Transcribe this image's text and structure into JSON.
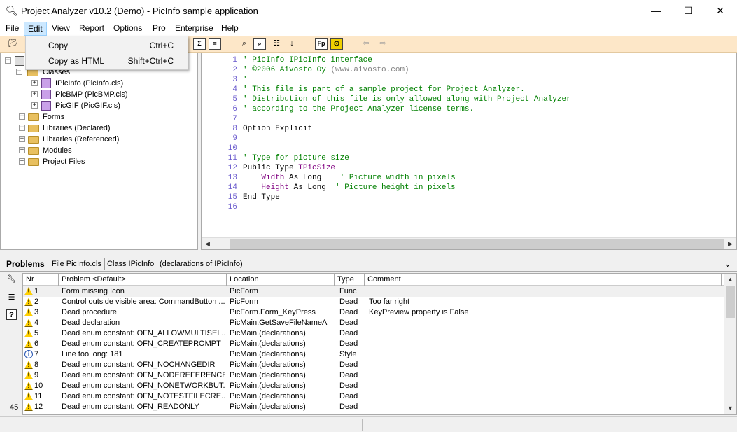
{
  "window": {
    "title": "Project Analyzer v10.2 (Demo) - PicInfo sample application",
    "app_icon": "magnifier-icon",
    "minimize": "—",
    "maximize": "☐",
    "close": "✕"
  },
  "menu": {
    "items": [
      "File",
      "Edit",
      "View",
      "Report",
      "Options",
      "Pro",
      "Enterprise",
      "Help"
    ],
    "active": "Edit"
  },
  "edit_menu": {
    "items": [
      {
        "label": "Copy",
        "shortcut": "Ctrl+C"
      },
      {
        "label": "Copy as HTML",
        "shortcut": "Shift+Ctrl+C"
      }
    ]
  },
  "toolbar": {
    "buttons": [
      "open-folder-icon",
      "sum-icon",
      "report-icon",
      "find-icon",
      "find-doc-icon",
      "flowchart-icon",
      "enum-icon",
      "fp-icon",
      "gear-icon",
      "back-arrow-icon",
      "forward-arrow-icon"
    ],
    "sum_glyph": "Σ",
    "fp_label": "Fp"
  },
  "tree": {
    "root_collapse": "−",
    "classes_label": "Classes",
    "expand_glyph": "+",
    "items": [
      {
        "label": "IPicInfo (PicInfo.cls)",
        "kind": "class"
      },
      {
        "label": "PicBMP (PicBMP.cls)",
        "kind": "class"
      },
      {
        "label": "PicGIF (PicGIF.cls)",
        "kind": "class"
      },
      {
        "label": "Forms",
        "kind": "folder"
      },
      {
        "label": "Libraries (Declared)",
        "kind": "folder"
      },
      {
        "label": "Libraries (Referenced)",
        "kind": "folder"
      },
      {
        "label": "Modules",
        "kind": "folder"
      },
      {
        "label": "Project Files",
        "kind": "folder"
      }
    ]
  },
  "code": {
    "lines": [
      {
        "n": "1",
        "parts": [
          {
            "t": "' PicInfo IPicInfo interface",
            "c": "c-comment"
          }
        ]
      },
      {
        "n": "2",
        "parts": [
          {
            "t": "' ©2006 Aivosto Oy ",
            "c": "c-comment"
          },
          {
            "t": "(www.aivosto.com)",
            "c": "c-gray"
          }
        ]
      },
      {
        "n": "3",
        "parts": [
          {
            "t": "'",
            "c": "c-comment"
          }
        ]
      },
      {
        "n": "4",
        "parts": [
          {
            "t": "' This file is part of a sample project for Project Analyzer.",
            "c": "c-comment"
          }
        ]
      },
      {
        "n": "5",
        "parts": [
          {
            "t": "' Distribution of this file is only allowed along with Project Analyzer",
            "c": "c-comment"
          }
        ]
      },
      {
        "n": "6",
        "parts": [
          {
            "t": "' according to the Project Analyzer license terms.",
            "c": "c-comment"
          }
        ]
      },
      {
        "n": "7",
        "parts": []
      },
      {
        "n": "8",
        "parts": [
          {
            "t": "Option Explicit",
            "c": ""
          }
        ]
      },
      {
        "n": "9",
        "parts": []
      },
      {
        "n": "10",
        "parts": []
      },
      {
        "n": "11",
        "parts": [
          {
            "t": "' Type for picture size",
            "c": "c-comment"
          }
        ]
      },
      {
        "n": "12",
        "parts": [
          {
            "t": "Public Type ",
            "c": ""
          },
          {
            "t": "TPicSize",
            "c": "c-type"
          }
        ]
      },
      {
        "n": "13",
        "parts": [
          {
            "t": "    ",
            "c": ""
          },
          {
            "t": "Width",
            "c": "c-var"
          },
          {
            "t": " As Long    ",
            "c": ""
          },
          {
            "t": "' Picture width in pixels",
            "c": "c-comment"
          }
        ]
      },
      {
        "n": "14",
        "parts": [
          {
            "t": "    ",
            "c": ""
          },
          {
            "t": "Height",
            "c": "c-var"
          },
          {
            "t": " As Long  ",
            "c": ""
          },
          {
            "t": "' Picture height in pixels",
            "c": "c-comment"
          }
        ]
      },
      {
        "n": "15",
        "parts": [
          {
            "t": "End Type",
            "c": ""
          }
        ]
      },
      {
        "n": "16",
        "parts": []
      }
    ]
  },
  "tabs": {
    "items": [
      "Problems",
      "File PicInfo.cls",
      "Class IPicInfo",
      "(declarations of IPicInfo)"
    ],
    "menu_glyph": "⌄"
  },
  "side_tools": {
    "icons": [
      "wrench-icon",
      "checklist-icon",
      "help-icon"
    ],
    "count": "45"
  },
  "problems": {
    "columns": [
      "Nr",
      "Problem <Default>",
      "Location",
      "Type",
      "Comment"
    ],
    "rows": [
      {
        "icon": "warning",
        "nr": "1",
        "problem": "Form missing Icon",
        "location": "PicForm",
        "type": "Func",
        "comment": ""
      },
      {
        "icon": "warning",
        "nr": "2",
        "problem": "Control outside visible area: CommandButton ...",
        "location": "PicForm",
        "type": "Dead",
        "comment": "Too far right"
      },
      {
        "icon": "warning",
        "nr": "3",
        "problem": "Dead procedure",
        "location": "PicForm.Form_KeyPress",
        "type": "Dead",
        "comment": "KeyPreview property is False"
      },
      {
        "icon": "warning",
        "nr": "4",
        "problem": "Dead declaration",
        "location": "PicMain.GetSaveFileNameA",
        "type": "Dead",
        "comment": ""
      },
      {
        "icon": "warning",
        "nr": "5",
        "problem": "Dead enum constant: OFN_ALLOWMULTISEL...",
        "location": "PicMain.(declarations)",
        "type": "Dead",
        "comment": ""
      },
      {
        "icon": "warning",
        "nr": "6",
        "problem": "Dead enum constant: OFN_CREATEPROMPT",
        "location": "PicMain.(declarations)",
        "type": "Dead",
        "comment": ""
      },
      {
        "icon": "info",
        "nr": "7",
        "problem": "Line too long: 181",
        "location": "PicMain.(declarations)",
        "type": "Style",
        "comment": ""
      },
      {
        "icon": "warning",
        "nr": "8",
        "problem": "Dead enum constant: OFN_NOCHANGEDIR",
        "location": "PicMain.(declarations)",
        "type": "Dead",
        "comment": ""
      },
      {
        "icon": "warning",
        "nr": "9",
        "problem": "Dead enum constant: OFN_NODEREFERENCE...",
        "location": "PicMain.(declarations)",
        "type": "Dead",
        "comment": ""
      },
      {
        "icon": "warning",
        "nr": "10",
        "problem": "Dead enum constant: OFN_NONETWORKBUT...",
        "location": "PicMain.(declarations)",
        "type": "Dead",
        "comment": ""
      },
      {
        "icon": "warning",
        "nr": "11",
        "problem": "Dead enum constant: OFN_NOTESTFILECRE...",
        "location": "PicMain.(declarations)",
        "type": "Dead",
        "comment": ""
      },
      {
        "icon": "warning",
        "nr": "12",
        "problem": "Dead enum constant: OFN_READONLY",
        "location": "PicMain.(declarations)",
        "type": "Dead",
        "comment": ""
      }
    ]
  },
  "glyphs": {
    "warning": "!",
    "info": "i",
    "up": "▲",
    "down": "▼",
    "left": "◀",
    "right": "▶"
  }
}
